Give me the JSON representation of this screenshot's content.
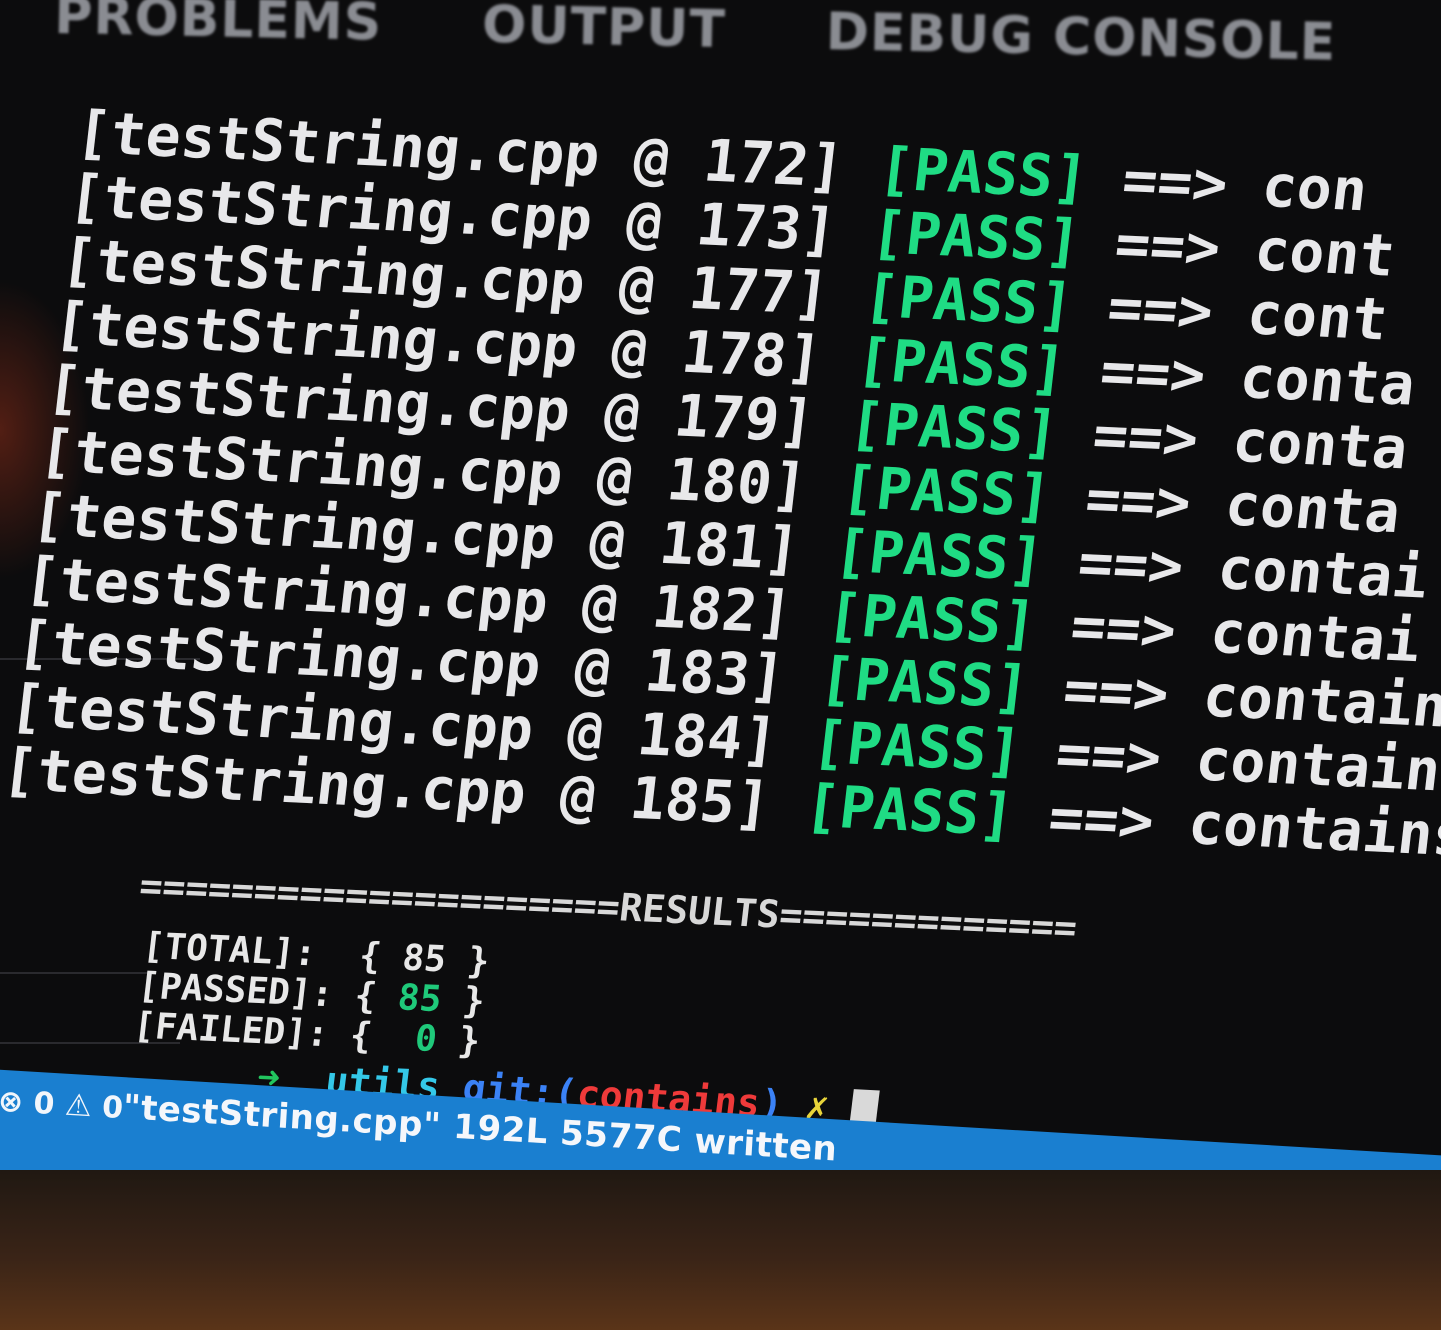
{
  "panel_tabs": [
    "PROBLEMS",
    "OUTPUT",
    "DEBUG CONSOLE"
  ],
  "test_lines": [
    {
      "file": "[testString.cpp @ 172]",
      "status": "[PASS]",
      "arrow": "==>",
      "desc": "con"
    },
    {
      "file": "[testString.cpp @ 173]",
      "status": "[PASS]",
      "arrow": "==>",
      "desc": "cont"
    },
    {
      "file": "[testString.cpp @ 177]",
      "status": "[PASS]",
      "arrow": "==>",
      "desc": "cont"
    },
    {
      "file": "[testString.cpp @ 178]",
      "status": "[PASS]",
      "arrow": "==>",
      "desc": "conta"
    },
    {
      "file": "[testString.cpp @ 179]",
      "status": "[PASS]",
      "arrow": "==>",
      "desc": "conta"
    },
    {
      "file": "[testString.cpp @ 180]",
      "status": "[PASS]",
      "arrow": "==>",
      "desc": "conta"
    },
    {
      "file": "[testString.cpp @ 181]",
      "status": "[PASS]",
      "arrow": "==>",
      "desc": "contai"
    },
    {
      "file": "[testString.cpp @ 182]",
      "status": "[PASS]",
      "arrow": "==>",
      "desc": "contai"
    },
    {
      "file": "[testString.cpp @ 183]",
      "status": "[PASS]",
      "arrow": "==>",
      "desc": "contain"
    },
    {
      "file": "[testString.cpp @ 184]",
      "status": "[PASS]",
      "arrow": "==>",
      "desc": "contain"
    },
    {
      "file": "[testString.cpp @ 185]",
      "status": "[PASS]",
      "arrow": "==>",
      "desc": "contains"
    }
  ],
  "results": {
    "separator": "=====================RESULTS=============",
    "total_label": "[TOTAL]:",
    "total_value": "85",
    "passed_label": "[PASSED]:",
    "passed_value": "85",
    "failed_label": "[FAILED]:",
    "failed_value": "0"
  },
  "prompt": {
    "arrow": "➜",
    "dir": "utils",
    "git_label": "git:(",
    "branch": "contains",
    "git_close": ")",
    "dirty_mark": "✗"
  },
  "statusbar": {
    "errors": "0",
    "warnings": "0",
    "message": "\"testString.cpp\" 192L 5577C written"
  },
  "colors": {
    "pass": "#1fdc84",
    "statusbar": "#1a7fd0",
    "branch": "#ef3a3a",
    "dir": "#34c8e8"
  },
  "icons": [
    "error-circle-icon",
    "warning-triangle-icon"
  ]
}
